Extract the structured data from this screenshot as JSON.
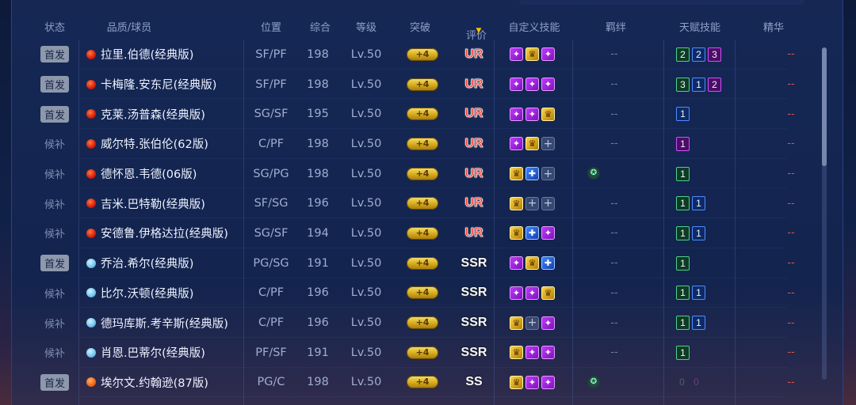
{
  "headers": {
    "status": "状态",
    "player": "品质/球员",
    "position": "位置",
    "overall": "综合",
    "level": "等级",
    "breakout": "突破",
    "rating": "评价",
    "custom_skills": "自定义技能",
    "bond": "羁绊",
    "talent": "天赋技能",
    "essence": "精华"
  },
  "rows": [
    {
      "status": "首发",
      "starter": true,
      "quality": "red",
      "name": "拉里.伯德(经典版)",
      "position": "SF/PF",
      "overall": "198",
      "level": "Lv.50",
      "breakout": "+4",
      "rating": "UR",
      "skills": [
        "purple-skill-icon",
        "gold-skill-icon",
        "purple-skill-icon"
      ],
      "bond": "--",
      "talents": [
        {
          "v": "2",
          "c": "green"
        },
        {
          "v": "2",
          "c": "blue"
        },
        {
          "v": "3",
          "c": "purple"
        }
      ],
      "essence": "--"
    },
    {
      "status": "首发",
      "starter": true,
      "quality": "red",
      "name": "卡梅隆.安东尼(经典版)",
      "position": "SF/PF",
      "overall": "198",
      "level": "Lv.50",
      "breakout": "+4",
      "rating": "UR",
      "skills": [
        "purple-skill-icon",
        "purple-skill-icon",
        "purple-skill-icon"
      ],
      "bond": "--",
      "talents": [
        {
          "v": "3",
          "c": "green"
        },
        {
          "v": "1",
          "c": "blue"
        },
        {
          "v": "2",
          "c": "purple"
        }
      ],
      "essence": "--"
    },
    {
      "status": "首发",
      "starter": true,
      "quality": "red",
      "name": "克莱.汤普森(经典版)",
      "position": "SG/SF",
      "overall": "195",
      "level": "Lv.50",
      "breakout": "+4",
      "rating": "UR",
      "skills": [
        "purple-skill-icon",
        "purple-skill-icon",
        "gold-skill-icon"
      ],
      "bond": "--",
      "talents": [
        {
          "v": "1",
          "c": "blue"
        }
      ],
      "essence": "--"
    },
    {
      "status": "候补",
      "starter": false,
      "quality": "red",
      "name": "威尔特.张伯伦(62版)",
      "position": "C/PF",
      "overall": "198",
      "level": "Lv.50",
      "breakout": "+4",
      "rating": "UR",
      "skills": [
        "purple-skill-icon",
        "gold-skill-icon",
        "empty-slot-icon"
      ],
      "bond": "--",
      "talents": [
        {
          "v": "1",
          "c": "purple"
        }
      ],
      "essence": "--"
    },
    {
      "status": "候补",
      "starter": false,
      "quality": "red",
      "name": "德怀恩.韦德(06版)",
      "position": "SG/PG",
      "overall": "198",
      "level": "Lv.50",
      "breakout": "+4",
      "rating": "UR",
      "skills": [
        "gold-skill-icon",
        "blue-skill-icon",
        "empty-slot-icon"
      ],
      "bond": "",
      "bond_icon": true,
      "talents": [
        {
          "v": "1",
          "c": "green"
        }
      ],
      "essence": "--"
    },
    {
      "status": "候补",
      "starter": false,
      "quality": "red",
      "name": "吉米.巴特勒(经典版)",
      "position": "SF/SG",
      "overall": "196",
      "level": "Lv.50",
      "breakout": "+4",
      "rating": "UR",
      "skills": [
        "gold-skill-icon",
        "empty-slot-icon",
        "empty-slot-icon"
      ],
      "bond": "--",
      "talents": [
        {
          "v": "1",
          "c": "green"
        },
        {
          "v": "1",
          "c": "blue"
        }
      ],
      "essence": "--"
    },
    {
      "status": "候补",
      "starter": false,
      "quality": "red",
      "name": "安德鲁.伊格达拉(经典版)",
      "position": "SG/SF",
      "overall": "194",
      "level": "Lv.50",
      "breakout": "+4",
      "rating": "UR",
      "skills": [
        "gold-skill-icon",
        "blue-skill-icon",
        "purple-skill-icon"
      ],
      "bond": "--",
      "talents": [
        {
          "v": "1",
          "c": "green"
        },
        {
          "v": "1",
          "c": "blue"
        }
      ],
      "essence": "--"
    },
    {
      "status": "首发",
      "starter": true,
      "quality": "blue",
      "name": "乔治.希尔(经典版)",
      "position": "PG/SG",
      "overall": "191",
      "level": "Lv.50",
      "breakout": "+4",
      "rating": "SSR",
      "skills": [
        "purple-skill-icon",
        "gold-skill-icon",
        "blue-skill-icon"
      ],
      "bond": "--",
      "talents": [
        {
          "v": "1",
          "c": "green"
        }
      ],
      "essence": "--"
    },
    {
      "status": "候补",
      "starter": false,
      "quality": "blue",
      "name": "比尔.沃顿(经典版)",
      "position": "C/PF",
      "overall": "196",
      "level": "Lv.50",
      "breakout": "+4",
      "rating": "SSR",
      "skills": [
        "purple-skill-icon",
        "purple-skill-icon",
        "gold-skill-icon"
      ],
      "bond": "--",
      "talents": [
        {
          "v": "1",
          "c": "green"
        },
        {
          "v": "1",
          "c": "blue"
        }
      ],
      "essence": "--"
    },
    {
      "status": "候补",
      "starter": false,
      "quality": "blue",
      "name": "德玛库斯.考辛斯(经典版)",
      "position": "C/PF",
      "overall": "196",
      "level": "Lv.50",
      "breakout": "+4",
      "rating": "SSR",
      "skills": [
        "gold-skill-icon",
        "empty-slot-icon",
        "purple-skill-icon"
      ],
      "bond": "--",
      "talents": [
        {
          "v": "1",
          "c": "green"
        },
        {
          "v": "1",
          "c": "blue"
        }
      ],
      "essence": "--"
    },
    {
      "status": "候补",
      "starter": false,
      "quality": "blue",
      "name": "肖恩.巴蒂尔(经典版)",
      "position": "PF/SF",
      "overall": "191",
      "level": "Lv.50",
      "breakout": "+4",
      "rating": "SSR",
      "skills": [
        "gold-skill-icon",
        "purple-skill-icon",
        "purple-skill-icon"
      ],
      "bond": "--",
      "talents": [
        {
          "v": "1",
          "c": "green"
        }
      ],
      "essence": "--"
    },
    {
      "status": "首发",
      "starter": true,
      "quality": "orange",
      "name": "埃尔文.约翰逊(87版)",
      "position": "PG/C",
      "overall": "198",
      "level": "Lv.50",
      "breakout": "+4",
      "rating": "SS",
      "skills": [
        "gold-skill-icon",
        "purple-skill-icon",
        "purple-skill-icon"
      ],
      "bond": "",
      "bond_icon": true,
      "talents": [
        {
          "v": "0",
          "c": "dimgreen"
        },
        {
          "v": "0",
          "c": "dimpurple"
        }
      ],
      "essence": "--"
    }
  ]
}
